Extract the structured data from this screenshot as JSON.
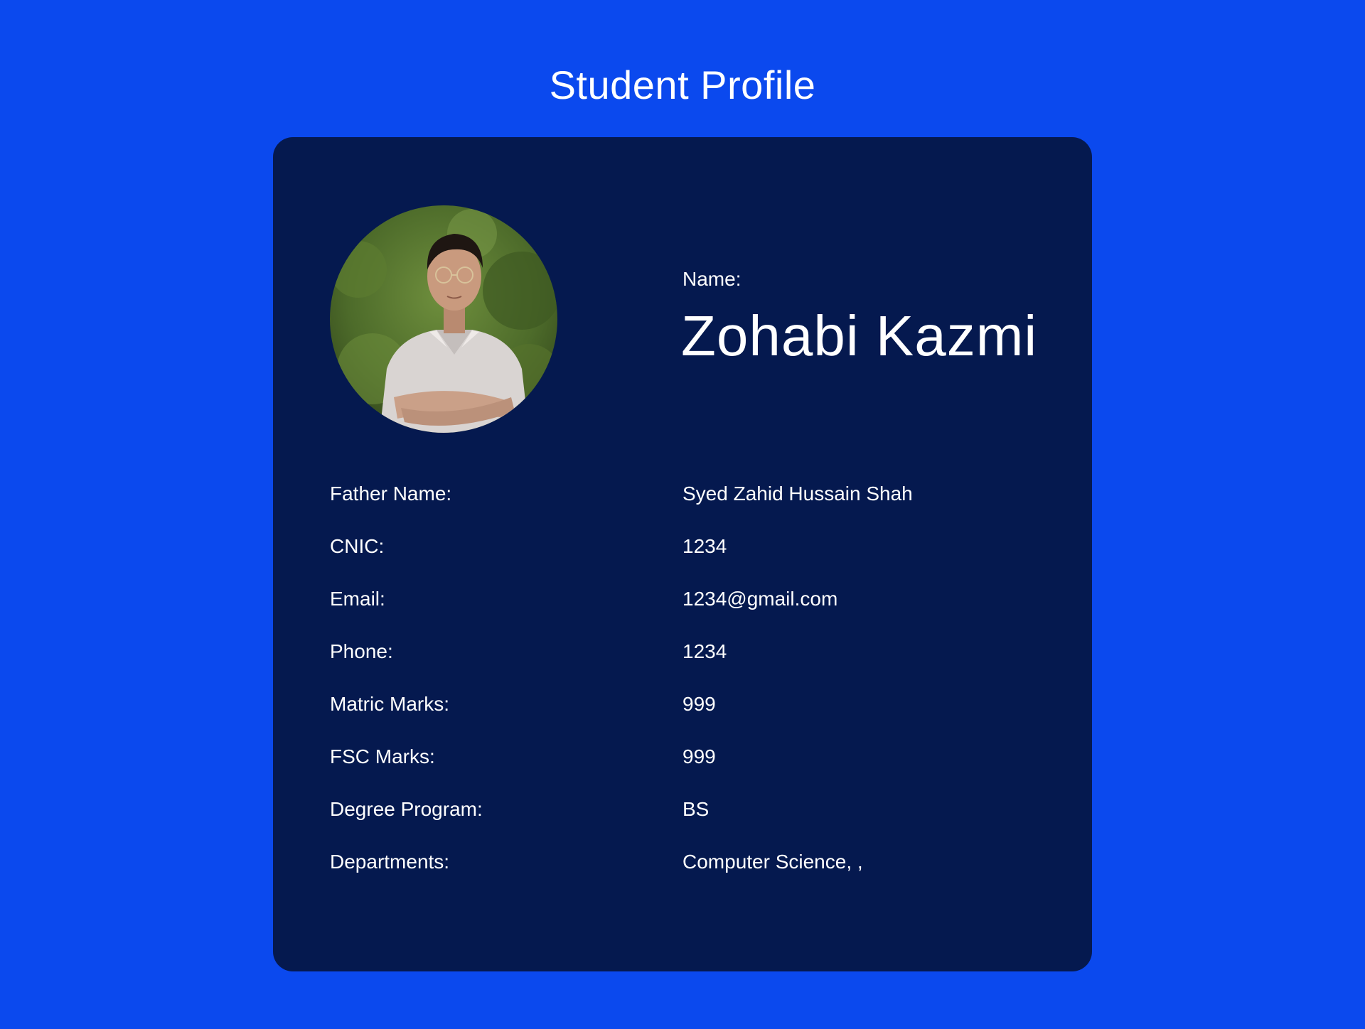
{
  "page": {
    "title": "Student Profile"
  },
  "profile": {
    "avatar_icon": "profile-photo",
    "name_label": "Name:",
    "name": "Zohabi Kazmi",
    "details": [
      {
        "label": "Father Name:",
        "value": "Syed Zahid Hussain Shah"
      },
      {
        "label": "CNIC:",
        "value": "1234"
      },
      {
        "label": "Email:",
        "value": "1234@gmail.com"
      },
      {
        "label": "Phone:",
        "value": "1234"
      },
      {
        "label": "Matric Marks:",
        "value": "999"
      },
      {
        "label": "FSC Marks:",
        "value": "999"
      },
      {
        "label": "Degree Program:",
        "value": "BS"
      },
      {
        "label": "Departments:",
        "value": "Computer Science, ,"
      }
    ]
  },
  "colors": {
    "background": "#0b49ee",
    "card": "#05194f",
    "text": "#ffffff"
  }
}
